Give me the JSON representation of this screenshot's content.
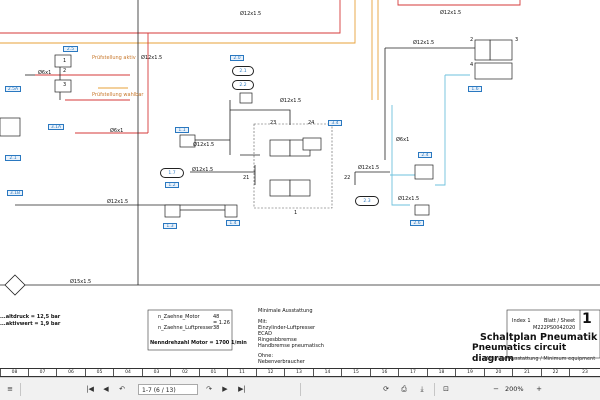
{
  "diagram": {
    "title_de": "Schaltplan Pneumatik",
    "title_en": "Pneumatics circuit diagram",
    "subtitle": "Minimale Ausstattung / Minimum equipment",
    "sheet_number": "1",
    "index_label": "Index 1",
    "sheet_label": "Blatt / Sheet",
    "doc_number": "M222PS0042020",
    "pipes": {
      "p12_top_left": "Ø12x1.5",
      "p12_top_mid": "Ø12x1.5",
      "p12_top_right": "Ø12x1.5",
      "p12_right_upper": "Ø12x1.5",
      "p12_vert_left": "Ø12x1.5",
      "p12_vert_mid": "Ø12x1.5",
      "p12_mid_a": "Ø12x1.5",
      "p12_mid_b": "Ø12x1.5",
      "p12_mid_c": "Ø12x1.5",
      "p12_right_mid": "Ø12x1.5",
      "p12_lower": "Ø12x1.5",
      "p12_lower_right": "Ø12x1.5",
      "p6_left": "Ø6x1",
      "p6_mid": "Ø6x1",
      "p6_right": "Ø6x1",
      "p15_bottom": "Ø15x1.5"
    },
    "orange_labels": [
      "Prüfstellung aktiv",
      "Prüfstellung wahlbar"
    ],
    "tags": [
      "2.5",
      "2.5A",
      "2.1",
      "3.1A",
      "3.1B",
      "1.1",
      "1.2",
      "1.3",
      "2.0",
      "1.4",
      "1.5",
      "3.4",
      "2.4",
      "1.6",
      "2.4",
      "2.6"
    ],
    "ovals": [
      "2.1",
      "2.2",
      "1.7",
      "2.3"
    ],
    "ports": [
      "23",
      "24",
      "21",
      "22",
      "1",
      "2",
      "3",
      "4",
      "1",
      "2",
      "3"
    ],
    "notes_left": [
      "...altdruck = 12,5 bar",
      "...aktivwert = 1,9 bar"
    ],
    "gear_box": {
      "motor_label": "n_Zaehne_Motor",
      "motor_value": "48",
      "pump_label": "n_Zaehne_Luftpresser",
      "pump_value": "38",
      "ratio_value": "= 1.26",
      "speed_label": "Nenndrehzahl Motor = 1700 1/min"
    },
    "equipment": {
      "title": "Minimale Ausstattung",
      "items": [
        "Mit:",
        "Einzylinder-Luftpresser",
        "ECAD",
        "Ringesbbremse",
        "Handbremse pneumatisch"
      ],
      "without_title": "Ohne:",
      "without_items": [
        "Nebenverbraucher"
      ]
    }
  },
  "ruler": [
    "08",
    "07",
    "06",
    "05",
    "04",
    "03",
    "02",
    "01",
    "11",
    "12",
    "13",
    "14",
    "15",
    "16",
    "17",
    "18",
    "19",
    "20",
    "21",
    "22",
    "23"
  ],
  "toolbar": {
    "page_value": "1-7 (6 / 13)",
    "zoom_value": "200%",
    "first_icon": "|◀",
    "prev_icon": "◀",
    "next_icon": "▶",
    "last_icon": "▶|",
    "back_icon": "↶",
    "fwd_icon": "↷",
    "zoom_out_icon": "−",
    "zoom_in_icon": "+",
    "fit_icon": "⊡",
    "menu_icon": "≡",
    "print_icon": "⎙",
    "save_icon": "⤓",
    "rotate_icon": "⟳"
  },
  "colors": {
    "pressure_line": "#d43a3a",
    "supply_line": "#e7a23a",
    "control_line": "#6ec1dc",
    "main_line": "#222222",
    "tag_blue": "#2a78c0"
  }
}
